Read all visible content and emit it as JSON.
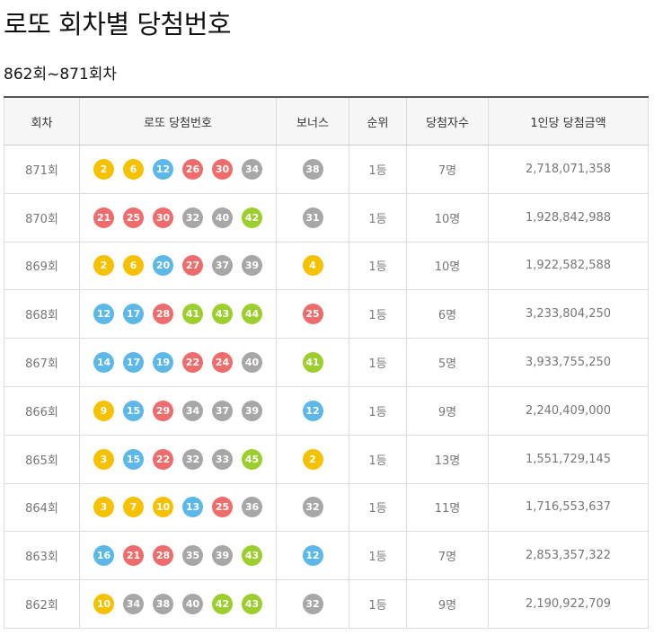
{
  "title": "로또 회차별 당첨번호",
  "subtitle": "862회~871회차",
  "headers": [
    "회차",
    "로또 당첨번호",
    "보너스",
    "순위",
    "당첨자수",
    "1인당 당첨금액"
  ],
  "ball_colors": {
    "yellow": "#f5c100",
    "blue": "#5bb8e8",
    "red": "#ef6c6c",
    "gray": "#a7a7a7",
    "green": "#9ccf2d"
  },
  "rows": [
    {
      "round": "871회",
      "numbers": [
        2,
        6,
        12,
        26,
        30,
        34
      ],
      "bonus": 38,
      "rank": "1등",
      "winners": "7명",
      "prize": "2,718,071,358"
    },
    {
      "round": "870회",
      "numbers": [
        21,
        25,
        30,
        32,
        40,
        42
      ],
      "bonus": 31,
      "rank": "1등",
      "winners": "10명",
      "prize": "1,928,842,988"
    },
    {
      "round": "869회",
      "numbers": [
        2,
        6,
        20,
        27,
        37,
        39
      ],
      "bonus": 4,
      "rank": "1등",
      "winners": "10명",
      "prize": "1,922,582,588"
    },
    {
      "round": "868회",
      "numbers": [
        12,
        17,
        28,
        41,
        43,
        44
      ],
      "bonus": 25,
      "rank": "1등",
      "winners": "6명",
      "prize": "3,233,804,250"
    },
    {
      "round": "867회",
      "numbers": [
        14,
        17,
        19,
        22,
        24,
        40
      ],
      "bonus": 41,
      "rank": "1등",
      "winners": "5명",
      "prize": "3,933,755,250"
    },
    {
      "round": "866회",
      "numbers": [
        9,
        15,
        29,
        34,
        37,
        39
      ],
      "bonus": 12,
      "rank": "1등",
      "winners": "9명",
      "prize": "2,240,409,000"
    },
    {
      "round": "865회",
      "numbers": [
        3,
        15,
        22,
        32,
        33,
        45
      ],
      "bonus": 2,
      "rank": "1등",
      "winners": "13명",
      "prize": "1,551,729,145"
    },
    {
      "round": "864회",
      "numbers": [
        3,
        7,
        10,
        13,
        25,
        36
      ],
      "bonus": 32,
      "rank": "1등",
      "winners": "11명",
      "prize": "1,716,553,637"
    },
    {
      "round": "863회",
      "numbers": [
        16,
        21,
        28,
        35,
        39,
        43
      ],
      "bonus": 12,
      "rank": "1등",
      "winners": "7명",
      "prize": "2,853,357,322"
    },
    {
      "round": "862회",
      "numbers": [
        10,
        34,
        38,
        40,
        42,
        43
      ],
      "bonus": 32,
      "rank": "1등",
      "winners": "9명",
      "prize": "2,190,922,709"
    }
  ]
}
